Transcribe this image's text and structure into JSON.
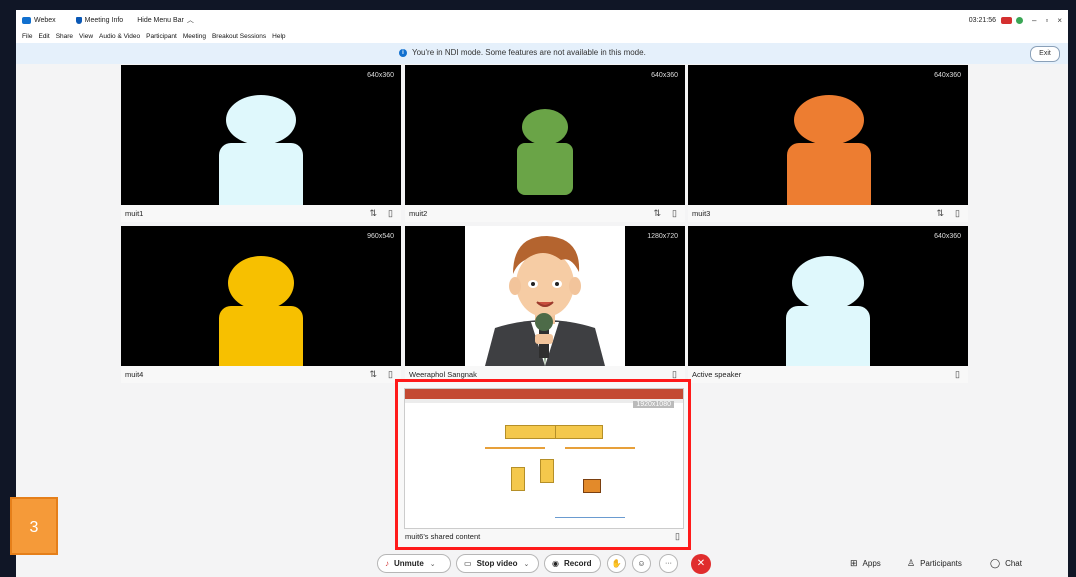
{
  "titlebar": {
    "app": "Webex",
    "meeting_info": "Meeting Info",
    "hide_menu": "Hide Menu Bar",
    "time": "03:21:56",
    "minimize": "–",
    "restore": "▫",
    "close": "×"
  },
  "menu": [
    "File",
    "Edit",
    "Share",
    "View",
    "Audio & Video",
    "Participant",
    "Meeting",
    "Breakout Sessions",
    "Help"
  ],
  "banner": {
    "message": "You're in NDI mode. Some features are not available in this mode.",
    "exit_label": "Exit"
  },
  "tiles": [
    {
      "name": "muit1",
      "res": "640x360",
      "head_color": "#dff8fc",
      "body_color": "#dff8fc"
    },
    {
      "name": "muit2",
      "res": "640x360",
      "head_color": "#6aa447",
      "body_color": "#6aa447"
    },
    {
      "name": "muit3",
      "res": "640x360",
      "head_color": "#ed7d31",
      "body_color": "#ed7d31"
    },
    {
      "name": "muit4",
      "res": "960x540",
      "head_color": "#f7c000",
      "body_color": "#f7c000"
    },
    {
      "name": "Weeraphol Sangnak",
      "res": "1280x720"
    },
    {
      "name": "Active speaker",
      "res": "640x360",
      "head_color": "#dff8fc",
      "body_color": "#dff8fc"
    }
  ],
  "share": {
    "name": "muit6's shared content",
    "res": "1920x1080"
  },
  "controls": {
    "unmute": "Unmute",
    "stop_video": "Stop video",
    "record": "Record",
    "more": "···",
    "apps": "Apps",
    "participants": "Participants",
    "chat": "Chat"
  },
  "step_badge": "3"
}
